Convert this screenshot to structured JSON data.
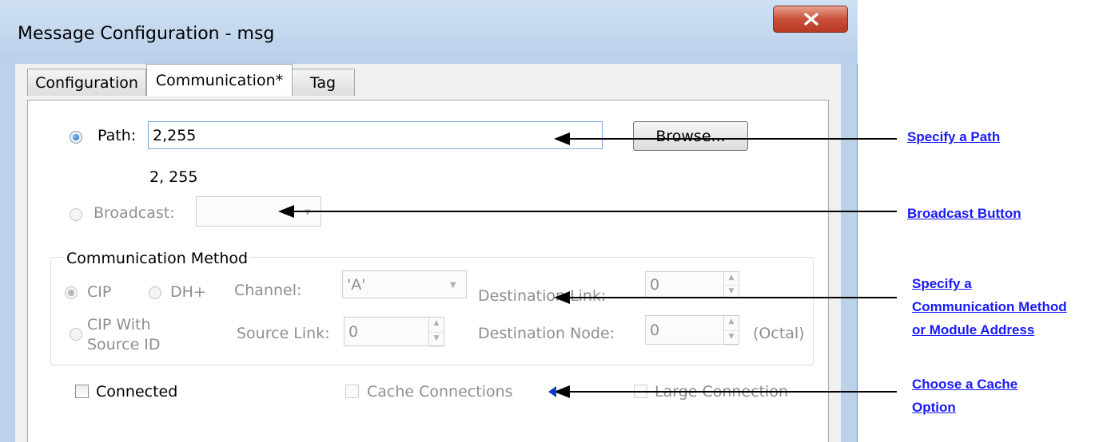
{
  "window": {
    "title": "Message Configuration - msg",
    "close_label": "X"
  },
  "tabs": [
    {
      "label": "Configuration"
    },
    {
      "label": "Communication*"
    },
    {
      "label": "Tag"
    }
  ],
  "path": {
    "label": "Path:",
    "value": "2,255",
    "resolved": "2, 255",
    "browse_label": "Browse..."
  },
  "broadcast": {
    "label": "Broadcast:",
    "value": ""
  },
  "comm_method": {
    "group_label": "Communication Method",
    "cip_label": "CIP",
    "dhplus_label": "DH+",
    "cip_source_label_1": "CIP With",
    "cip_source_label_2": "Source ID",
    "channel_label": "Channel:",
    "channel_value": "'A'",
    "dest_link_label": "Destination Link:",
    "dest_link_value": "0",
    "source_link_label": "Source Link:",
    "source_link_value": "0",
    "dest_node_label": "Destination Node:",
    "dest_node_value": "0",
    "octal_label": "(Octal)"
  },
  "options": {
    "connected_label": "Connected",
    "cache_label": "Cache Connections",
    "large_label": "Large Connection"
  },
  "annotations": {
    "specify_path": "Specify a Path",
    "broadcast_button": "Broadcast Button",
    "comm_method_1": "Specify a",
    "comm_method_2": "Communication Method",
    "comm_method_3": "or Module Address",
    "cache_1": "Choose a Cache",
    "cache_2": "Option"
  },
  "colors": {
    "link": "#1a1aff",
    "close_button": "#c9503a",
    "window_frame": "#bcd2ea"
  }
}
